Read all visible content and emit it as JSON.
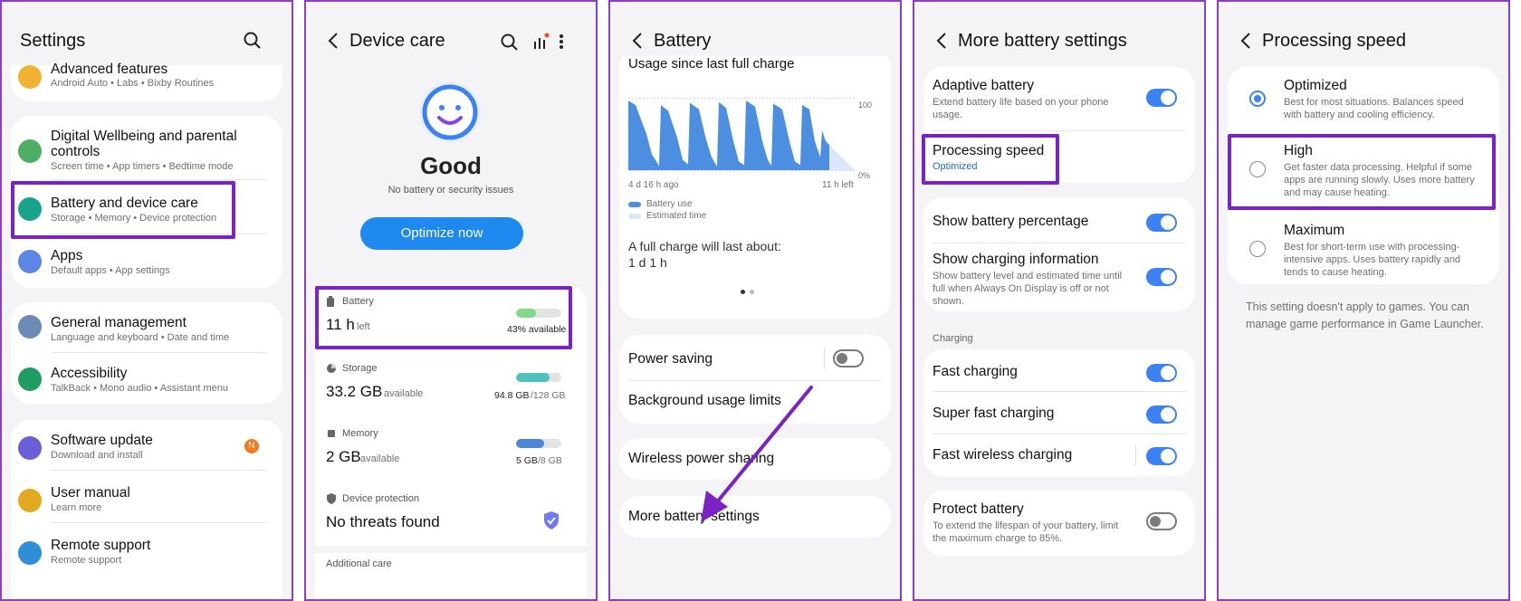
{
  "panel1": {
    "title": "Settings",
    "items": [
      {
        "label": "Advanced features",
        "sub": "Android Auto  •  Labs  •  Bixby Routines"
      },
      {
        "label": "Digital Wellbeing and parental",
        "label2": "controls",
        "sub": "Screen time  •  App timers  •  Bedtime mode"
      },
      {
        "label": "Battery and device care",
        "sub": "Storage  •  Memory  •  Device protection"
      },
      {
        "label": "Apps",
        "sub": "Default apps  •  App settings"
      },
      {
        "label": "General management",
        "sub": "Language and keyboard  •  Date and time"
      },
      {
        "label": "Accessibility",
        "sub": "TalkBack  •  Mono audio  •  Assistant menu"
      },
      {
        "label": "Software update",
        "sub": "Download and install",
        "badge": "N"
      },
      {
        "label": "User manual",
        "sub": "Learn more"
      },
      {
        "label": "Remote support",
        "sub": "Remote support"
      }
    ]
  },
  "panel2": {
    "title": "Device care",
    "status": "Good",
    "status_sub": "No battery or security issues",
    "optimize": "Optimize now",
    "battery": {
      "label": "Battery",
      "value": "11 h",
      "unit": "left",
      "detail": "43% available",
      "fill": 0.43
    },
    "storage": {
      "label": "Storage",
      "value": "33.2 GB",
      "unit": "available",
      "detail_a": "94.8 GB",
      "detail_b": "/128 GB",
      "fill": 0.74
    },
    "memory": {
      "label": "Memory",
      "value": "2 GB",
      "unit": "available",
      "detail_a": "5 GB",
      "detail_b": "/8 GB",
      "fill": 0.62
    },
    "protection": {
      "label": "Device protection",
      "value": "No threats found"
    },
    "additional": "Additional care"
  },
  "panel3": {
    "title": "Battery",
    "usage_title": "Usage since last full charge",
    "chart_y_top": "100",
    "chart_y_bottom": "0%",
    "chart_x_left": "4 d 16 h ago",
    "chart_x_right": "11 h left",
    "legend_use": "Battery use",
    "legend_est": "Estimated time",
    "full_charge": "A full charge will last about:",
    "full_value": "1 d 1 h",
    "power_saving": "Power saving",
    "bg_limits": "Background usage limits",
    "wireless": "Wireless power sharing",
    "more": "More battery settings"
  },
  "panel4": {
    "title": "More battery settings",
    "adaptive": "Adaptive battery",
    "adaptive_sub": "Extend battery life based on your phone usage.",
    "proc": "Processing speed",
    "proc_val": "Optimized",
    "show_pct": "Show battery percentage",
    "show_chg": "Show charging information",
    "show_chg_sub": "Show battery level and estimated time until full when Always On Display is off or not shown.",
    "charging_hdr": "Charging",
    "fast": "Fast charging",
    "superfast": "Super fast charging",
    "wireless": "Fast wireless charging",
    "protect": "Protect battery",
    "protect_sub": "To extend the lifespan of your battery, limit the maximum charge to 85%."
  },
  "panel5": {
    "title": "Processing speed",
    "options": [
      {
        "label": "Optimized",
        "sub": "Best for most situations. Balances speed with battery and cooling efficiency."
      },
      {
        "label": "High",
        "sub": "Get faster data processing. Helpful if some apps are running slowly. Uses more battery and may cause heating."
      },
      {
        "label": "Maximum",
        "sub": "Best for short-term use with processing-intensive apps. Uses battery rapidly and tends to cause heating."
      }
    ],
    "note": "This setting doesn't apply to games. You can manage game performance in Game Launcher."
  }
}
